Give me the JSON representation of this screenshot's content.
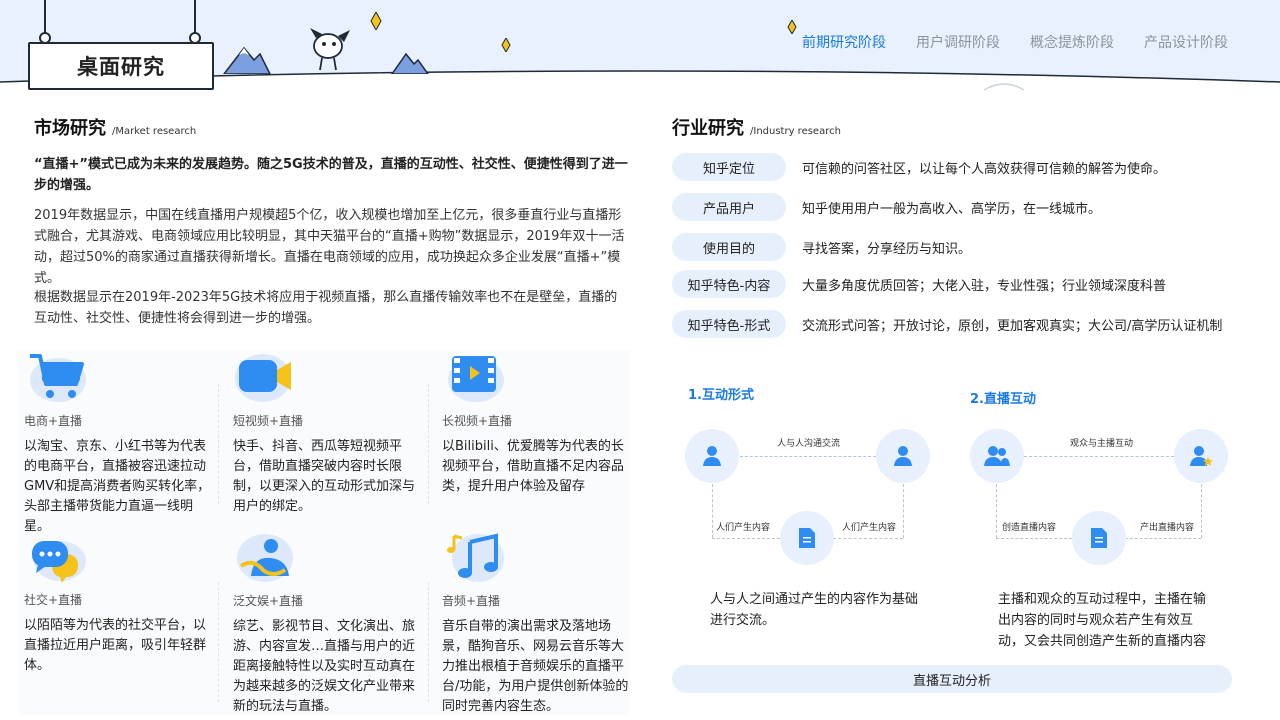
{
  "header": {
    "title": "桌面研究",
    "nav": [
      "前期研究阶段",
      "用户调研阶段",
      "概念提炼阶段",
      "产品设计阶段"
    ],
    "active_nav": 0
  },
  "market": {
    "title": "市场研究",
    "subtitle": "/Market research",
    "lead": "“直播+”模式已成为未来的发展趋势。随之5G技术的普及，直播的互动性、社交性、便捷性得到了进一步的增强。",
    "para1": "2019年数据显示，中国在线直播用户规模超5个亿，收入规模也增加至上亿元，很多垂直行业与直播形式融合，尤其游戏、电商领域应用比较明显，其中天猫平台的“直播+购物”数据显示，2019年双十一活动，超过50%的商家通过直播获得新增长。直播在电商领域的应用，成功换起众多企业发展“直播+”模式。",
    "para2": "根据数据显示在2019年-2023年5G技术将应用于视频直播，那么直播传输效率也不在是壁垒，直播的互动性、社交性、便捷性将会得到进一步的增强。",
    "cards": [
      {
        "icon": "shopping-cart-icon",
        "label": "电商+直播",
        "desc": "以淘宝、京东、小红书等为代表的电商平台，直播被容迅速拉动GMV和提高消费者购买转化率，头部主播带货能力直逼一线明星。"
      },
      {
        "icon": "video-camera-icon",
        "label": "短视频+直播",
        "desc": "快手、抖音、西瓜等短视频平台，借助直播突破内容时长限制，以更深入的互动形式加深与用户的绑定。"
      },
      {
        "icon": "film-play-icon",
        "label": "长视频+直播",
        "desc": "以Bilibili、优爱腾等为代表的长视频平台，借助直播不足内容品类，提升用户体验及留存"
      },
      {
        "icon": "chat-bubble-icon",
        "label": "社交+直播",
        "desc": "以陌陌等为代表的社交平台，以直播拉近用户距离，吸引年轻群体。"
      },
      {
        "icon": "entertainment-icon",
        "label": "泛文娱+直播",
        "desc": "综艺、影视节目、文化演出、旅游、内容宣发…直播与用户的近距离接触特性以及实时互动真在为越来越多的泛娱文化产业带来新的玩法与直播。"
      },
      {
        "icon": "music-note-icon",
        "label": "音频+直播",
        "desc": "音乐自带的演出需求及落地场景，酷狗音乐、网易云音乐等大力推出根植于音频娱乐的直播平台/功能，为用户提供创新体验的同时完善内容生态。"
      }
    ]
  },
  "industry": {
    "title": "行业研究",
    "subtitle": "/Industry research",
    "rows": [
      {
        "label": "知乎定位",
        "text": "可信赖的问答社区，以让每个人高效获得可信赖的解答为使命。"
      },
      {
        "label": "产品用户",
        "text": "知乎使用用户一般为高收入、高学历，在一线城市。"
      },
      {
        "label": "使用目的",
        "text": "寻找答案，分享经历与知识。"
      },
      {
        "label": "知乎特色-内容",
        "text": "大量多角度优质回答；大佬入驻，专业性强；行业领域深度科普"
      },
      {
        "label": "知乎特色-形式",
        "text": "交流形式问答；开放讨论，原创，更加客观真实；大公司/高学历认证机制"
      }
    ],
    "flow1": {
      "title": "1.互动形式",
      "top_label": "人与人沟通交流",
      "left_label": "人们产生内容",
      "right_label": "人们产生内容",
      "desc": "人与人之间通过产生的内容作为基础进行交流。"
    },
    "flow2": {
      "title": "2.直播互动",
      "top_label": "观众与主播互动",
      "left_label": "创造直播内容",
      "right_label": "产出直播内容",
      "desc": "主播和观众的互动过程中，主播在输出内容的同时与观众若产生有效互动，又会共同创造产生新的直播内容"
    },
    "bottom_bar": "直播互动分析"
  },
  "colors": {
    "accent": "#1a7ae6",
    "pill": "#e6f0fc",
    "header_bg": "#e8f1fd"
  }
}
